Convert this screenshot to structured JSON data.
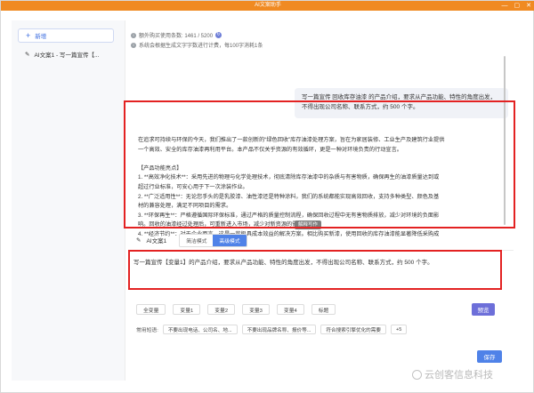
{
  "window": {
    "title": "AI文案助手"
  },
  "sidebar": {
    "new_label": "新增",
    "items": [
      {
        "label": "AI文案1 - 写一篇宣传【..."
      }
    ]
  },
  "info": {
    "usage": "额外购买使用条数: 1461 / 5200",
    "note": "系统会根据生成文字字数进行计费，每100字消耗1条"
  },
  "chat": {
    "user_prompt": "写一篇宣传 回收库存油漆 的产品介绍，要求从产品功能、特性的角度出发，不得出现公司名称、联系方式，约 500 个字。",
    "answer_lines": [
      "在追求可持续与环保的今天，我们推出了一款创新的“绿色回收”库存油漆处理方案，旨在为家居装修、工业生产及建筑行业提供",
      "一个高效、安全的库存油漆再利用平台。本产品不仅关乎资源的有效循环，更是一种对环境负责的行动宣言。",
      "",
      "【产品功能亮点】",
      "1. **高效净化技术**：采用先进的物理与化学处理技术，彻底清除库存油漆中的杂质与有害物质，确保再生的油漆质量达到或",
      "超过行业标准，可安心用于下一次涂装作业。",
      "2. **广泛适用性**：无论您手头的是乳胶漆、油性漆还是特种涂料，我们的系统都能实现高效回收，支持多种类型、颜色及基",
      "材的兼容处理，满足不同项目的需求。",
      "3. **环保再生**：严格遵循国际环保标准，通过严格的质量控制流程，确保回收过程中无有害物质排放，减少对环境的负面影",
      "响。回收的油漆经过处理后，可重新进入市场，减少对新资源的需求。",
      "4. **经济节约**：对于企业而言，这是一款极具成本效益的解决方案。相比购买新漆，使用回收的库存油漆能显著降低采购成"
    ],
    "floating_label": "解释写作"
  },
  "editor": {
    "title": "AI文案1",
    "mode_simple": "简洁模式",
    "mode_advanced": "高级模式",
    "prompt": "写一篇宣传【变量1】的产品介绍，要求从产品功能、特性的角度出发，不得出现公司名称、联系方式，约 500 个字。"
  },
  "variables": [
    "全变量",
    "变量1",
    "变量2",
    "变量3",
    "变量4",
    "标题"
  ],
  "preview_label": "预览",
  "phrases": {
    "label": "常用短语:",
    "items": [
      "不要出现电话、公司名、地...",
      "不要出现品牌名称、报价等...",
      "符合搜索引擎优化的需要"
    ],
    "more": "+5"
  },
  "save_label": "保存",
  "watermark": "云创客信息科技"
}
